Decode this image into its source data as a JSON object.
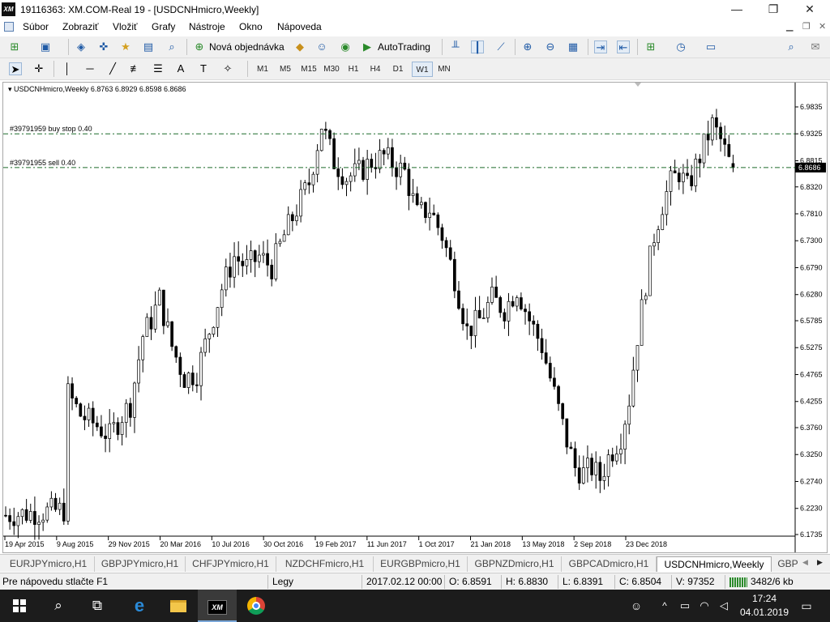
{
  "window": {
    "logo": "XM",
    "title": "19116363: XM.COM-Real 19 - [USDCNHmicro,Weekly]",
    "minimize": "—",
    "restore": "❐",
    "close": "✕"
  },
  "menu": [
    "Súbor",
    "Zobraziť",
    "Vložiť",
    "Grafy",
    "Nástroje",
    "Okno",
    "Nápoveda"
  ],
  "toolbar": {
    "new_order": "Nová objednávka",
    "autotrading": "AutoTrading"
  },
  "timeframes": [
    "M1",
    "M5",
    "M15",
    "M30",
    "H1",
    "H4",
    "D1",
    "W1",
    "MN"
  ],
  "active_timeframe": "W1",
  "chart": {
    "info": "USDCNHmicro,Weekly  6.8763 6.8929 6.8598 6.8686",
    "orders": [
      {
        "label": "#39791959 buy stop 0.40",
        "price": 6.9325
      },
      {
        "label": "#39791955 sell 0.40",
        "price": 6.8686
      }
    ],
    "current_price": "6.8686",
    "colors": {
      "candle": "#000000",
      "order_line": "#1c6b2a",
      "price_label_bg": "#000000"
    }
  },
  "chart_data": {
    "type": "candlestick",
    "symbol": "USDCNHmicro",
    "timeframe": "Weekly",
    "ohlc_last": {
      "open": 6.8763,
      "high": 6.8929,
      "low": 6.8598,
      "close": 6.8686
    },
    "y_ticks": [
      6.9835,
      6.9325,
      6.8815,
      6.832,
      6.781,
      6.73,
      6.679,
      6.628,
      6.5785,
      6.5275,
      6.4765,
      6.4255,
      6.376,
      6.325,
      6.274,
      6.223,
      6.1735
    ],
    "ylim": [
      6.1735,
      6.9835
    ],
    "x_ticks": [
      "19 Apr 2015",
      "9 Aug 2015",
      "29 Nov 2015",
      "20 Mar 2016",
      "10 Jul 2016",
      "30 Oct 2016",
      "19 Feb 2017",
      "11 Jun 2017",
      "1 Oct 2017",
      "21 Jan 2018",
      "13 May 2018",
      "2 Sep 2018",
      "23 Dec 2018"
    ],
    "x_range_weeks": [
      0,
      195
    ],
    "close_path": [
      [
        0,
        6.21
      ],
      [
        14,
        6.22
      ],
      [
        15,
        6.44
      ],
      [
        18,
        6.4
      ],
      [
        22,
        6.38
      ],
      [
        25,
        6.36
      ],
      [
        28,
        6.4
      ],
      [
        30,
        6.42
      ],
      [
        33,
        6.55
      ],
      [
        35,
        6.58
      ],
      [
        37,
        6.62
      ],
      [
        40,
        6.53
      ],
      [
        43,
        6.47
      ],
      [
        46,
        6.48
      ],
      [
        49,
        6.56
      ],
      [
        52,
        6.64
      ],
      [
        55,
        6.7
      ],
      [
        58,
        6.68
      ],
      [
        61,
        6.7
      ],
      [
        64,
        6.68
      ],
      [
        67,
        6.74
      ],
      [
        70,
        6.79
      ],
      [
        73,
        6.84
      ],
      [
        76,
        6.95
      ],
      [
        79,
        6.88
      ],
      [
        82,
        6.85
      ],
      [
        85,
        6.86
      ],
      [
        88,
        6.88
      ],
      [
        91,
        6.89
      ],
      [
        94,
        6.87
      ],
      [
        96,
        6.86
      ],
      [
        99,
        6.78
      ],
      [
        102,
        6.79
      ],
      [
        105,
        6.74
      ],
      [
        108,
        6.66
      ],
      [
        111,
        6.56
      ],
      [
        114,
        6.58
      ],
      [
        117,
        6.62
      ],
      [
        120,
        6.6
      ],
      [
        123,
        6.64
      ],
      [
        126,
        6.58
      ],
      [
        129,
        6.53
      ],
      [
        132,
        6.44
      ],
      [
        135,
        6.35
      ],
      [
        137,
        6.3
      ],
      [
        139,
        6.29
      ],
      [
        141,
        6.3
      ],
      [
        143,
        6.28
      ],
      [
        145,
        6.32
      ],
      [
        148,
        6.36
      ],
      [
        150,
        6.43
      ],
      [
        152,
        6.55
      ],
      [
        154,
        6.65
      ],
      [
        156,
        6.74
      ],
      [
        158,
        6.8
      ],
      [
        160,
        6.84
      ],
      [
        162,
        6.86
      ],
      [
        164,
        6.83
      ],
      [
        166,
        6.87
      ],
      [
        168,
        6.91
      ],
      [
        170,
        6.95
      ],
      [
        172,
        6.92
      ],
      [
        174,
        6.88
      ],
      [
        175,
        6.87
      ]
    ],
    "grid": false,
    "legend": "none"
  },
  "tabs": [
    "EURJPYmicro,H1",
    "GBPJPYmicro,H1",
    "CHFJPYmicro,H1",
    "NZDCHFmicro,H1",
    "EURGBPmicro,H1",
    "GBPNZDmicro,H1",
    "GBPCADmicro,H1",
    "USDCNHmicro,Weekly",
    "GBP"
  ],
  "active_tab": "USDCNHmicro,Weekly",
  "status": {
    "help": "Pre nápovedu stlačte F1",
    "profile": "Legy",
    "datetime": "2017.02.12 00:00",
    "open": "O: 6.8591",
    "high": "H: 6.8830",
    "low": "L: 6.8391",
    "close": "C: 6.8504",
    "volume": "V: 97352",
    "traffic": "3482/6 kb"
  },
  "taskbar": {
    "time": "17:24",
    "date": "04.01.2019",
    "mt_label": "XM"
  }
}
